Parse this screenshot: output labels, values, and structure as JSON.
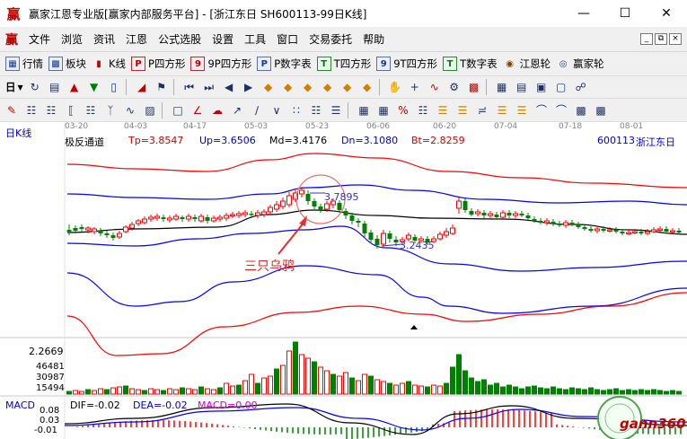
{
  "window": {
    "title": "赢家江恩专业版[赢家内部服务平台] - [浙江东日  SH600113-99日K线]",
    "logo": "赢"
  },
  "menu": [
    "文件",
    "浏览",
    "资讯",
    "江恩",
    "公式选股",
    "设置",
    "工具",
    "窗口",
    "交易委托",
    "帮助"
  ],
  "toolbar1": [
    {
      "label": "行情",
      "icon": "grid-icon"
    },
    {
      "label": "板块",
      "icon": "blocks-icon"
    },
    {
      "label": "K线",
      "icon": "candles-icon"
    },
    {
      "label": "P四方形",
      "icon": "p-square-icon"
    },
    {
      "label": "9P四方形",
      "icon": "9p-square-icon"
    },
    {
      "label": "P数字表",
      "icon": "pn-table-icon"
    },
    {
      "label": "T四方形",
      "icon": "t-square-icon"
    },
    {
      "label": "9T四方形",
      "icon": "9t-square-icon"
    },
    {
      "label": "T数字表",
      "icon": "tn-table-icon"
    },
    {
      "label": "江恩轮",
      "icon": "gann-wheel-icon"
    },
    {
      "label": "赢家轮",
      "icon": "winner-wheel-icon"
    }
  ],
  "toolbar2_first": "日",
  "chart": {
    "panel_label": "日K线",
    "indicator_name": "极反通道",
    "tp": "Tp=3.8547",
    "up": "Up=3.6506",
    "md": "Md=3.4176",
    "dn": "Dn=3.1080",
    "bt": "Bt=2.8259",
    "stock_code": "600113",
    "stock_name": "浙江东日",
    "dates": [
      "03-20",
      "04-03",
      "04-17",
      "05-03",
      "05-23",
      "06-06",
      "06-20",
      "07-04",
      "07-18",
      "08-01"
    ],
    "annotation_high": "3.7895",
    "annotation_low": "3.2435",
    "pattern_label": "三只乌鸦",
    "volume_max": "2.2669",
    "volume_ticks": [
      "46481",
      "30987",
      "15494"
    ],
    "macd_label": "MACD",
    "dif": "DIF=-0.02",
    "dea": "DEA=-0.02",
    "macd": "MACD=0.00",
    "macd_ticks": [
      "0.08",
      "0.03",
      "-0.01"
    ],
    "watermark": "gann360",
    "colors": {
      "up": "#ff0000",
      "down": "#008000",
      "blue": "#0000ff",
      "dark": "#000000",
      "accent": "#cc0000"
    }
  }
}
